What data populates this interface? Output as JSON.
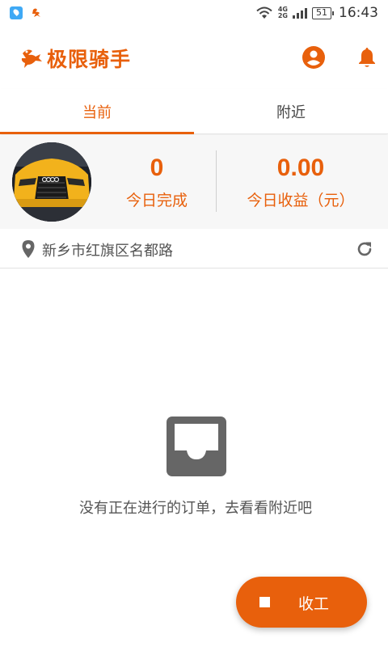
{
  "status_bar": {
    "network_top": "4G",
    "network_bottom": "2G",
    "battery": "51",
    "time": "16:43"
  },
  "app": {
    "brand_name": "极限骑手"
  },
  "tabs": [
    {
      "label": "当前",
      "active": true
    },
    {
      "label": "附近",
      "active": false
    }
  ],
  "stats": {
    "completed_value": "0",
    "completed_label": "今日完成",
    "earnings_value": "0.00",
    "earnings_label": "今日收益（元）"
  },
  "location": {
    "address": "新乡市红旗区名都路"
  },
  "empty_state": {
    "message": "没有正在进行的订单，去看看附近吧"
  },
  "fab": {
    "label": "收工"
  },
  "colors": {
    "accent": "#e8600c",
    "stats_background": "#f7f7f7",
    "icon_gray": "#666666"
  },
  "icons": {
    "status_app_1": "map-pin-app-icon",
    "status_app_2": "rider-logo-icon",
    "account": "account-circle-icon",
    "notifications": "bell-icon",
    "location": "location-pin-icon",
    "refresh": "refresh-icon",
    "empty": "inbox-tray-icon",
    "fab": "stop-square-icon"
  }
}
